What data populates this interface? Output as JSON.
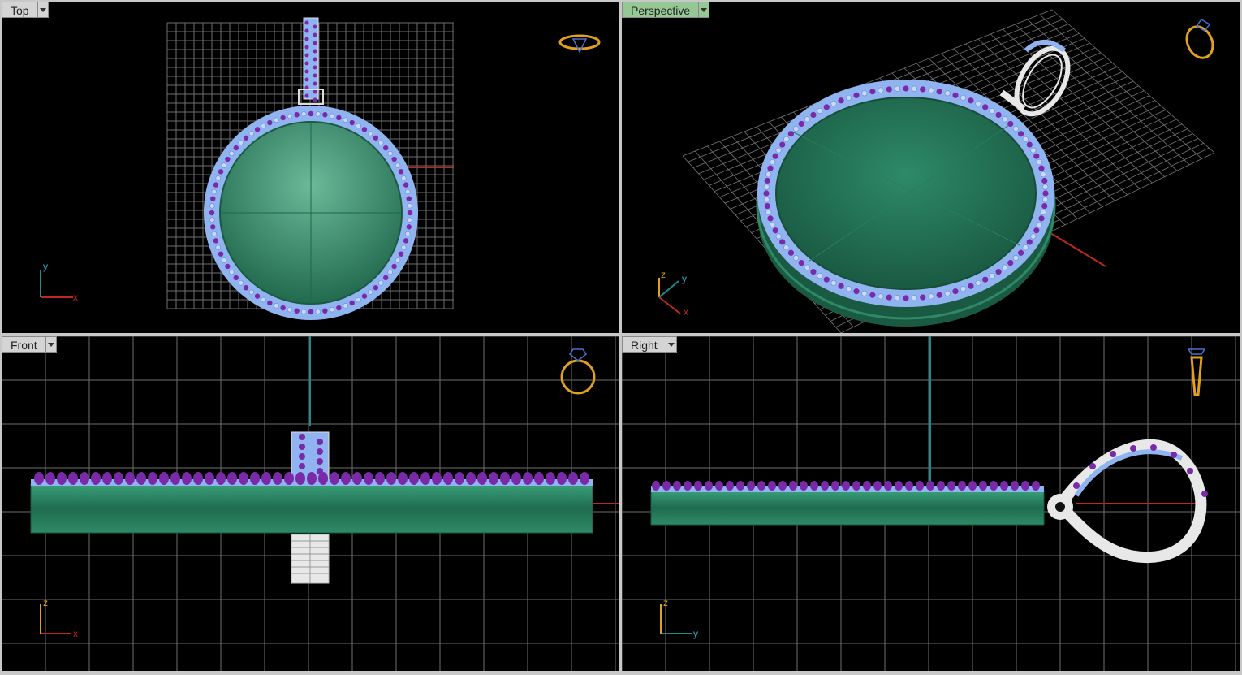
{
  "viewports": {
    "top": {
      "title": "Top",
      "axis_x": "x",
      "axis_y": "y"
    },
    "perspective": {
      "title": "Perspective",
      "axis_x": "x",
      "axis_y": "y",
      "axis_z": "z"
    },
    "front": {
      "title": "Front",
      "axis_x": "x",
      "axis_z": "z"
    },
    "right": {
      "title": "Right",
      "axis_y": "y",
      "axis_z": "z"
    }
  },
  "active_viewport": "perspective",
  "colors": {
    "viewport_bg": "#000000",
    "grid": "#9a9a9a",
    "metal": "#2e8a66",
    "gem_rim": "#8fb4f0",
    "prong": "#7a2aa8",
    "bail": "#e8e8e8",
    "axis_x": "#c0281e",
    "axis_y": "#1e8a8a",
    "gizmo": "#e0a020",
    "active_tab": "#96c896",
    "tab": "#d4d4d4"
  },
  "icons": [
    "ring-view-gizmo-icon",
    "dropdown-arrow-icon",
    "axis-triad-icon"
  ]
}
